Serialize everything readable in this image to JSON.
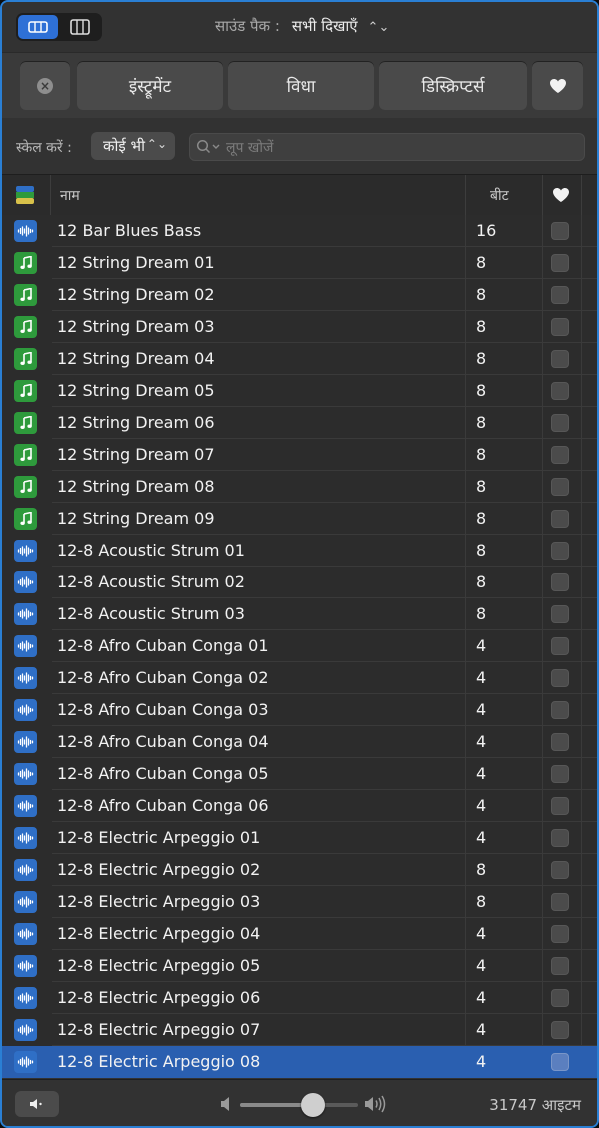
{
  "topbar": {
    "sound_pack_label": "साउंड पैक :",
    "sound_pack_value": "सभी दिखाएँ",
    "view_modes": [
      "button-view-icon",
      "column-view-icon"
    ]
  },
  "filters": {
    "clear_icon": "clear-icon",
    "instrument": "इंस्ट्रूमेंट",
    "genre": "विधा",
    "descriptors": "डिस्क्रिप्टर्स",
    "favorites_icon": "heart-icon"
  },
  "scale": {
    "label": "स्केल करें :",
    "value": "कोई भी"
  },
  "search": {
    "placeholder": "लूप खोजें",
    "value": ""
  },
  "table": {
    "columns": {
      "type_icon": "loop-type-icon",
      "name": "नाम",
      "beats": "बीट",
      "favorite_icon": "heart-icon"
    },
    "rows": [
      {
        "type": "audio",
        "name": "12 Bar Blues Bass",
        "beats": "16",
        "favorite": false,
        "selected": false
      },
      {
        "type": "midi",
        "name": "12 String Dream 01",
        "beats": "8",
        "favorite": false,
        "selected": false
      },
      {
        "type": "midi",
        "name": "12 String Dream 02",
        "beats": "8",
        "favorite": false,
        "selected": false
      },
      {
        "type": "midi",
        "name": "12 String Dream 03",
        "beats": "8",
        "favorite": false,
        "selected": false
      },
      {
        "type": "midi",
        "name": "12 String Dream 04",
        "beats": "8",
        "favorite": false,
        "selected": false
      },
      {
        "type": "midi",
        "name": "12 String Dream 05",
        "beats": "8",
        "favorite": false,
        "selected": false
      },
      {
        "type": "midi",
        "name": "12 String Dream 06",
        "beats": "8",
        "favorite": false,
        "selected": false
      },
      {
        "type": "midi",
        "name": "12 String Dream 07",
        "beats": "8",
        "favorite": false,
        "selected": false
      },
      {
        "type": "midi",
        "name": "12 String Dream 08",
        "beats": "8",
        "favorite": false,
        "selected": false
      },
      {
        "type": "midi",
        "name": "12 String Dream 09",
        "beats": "8",
        "favorite": false,
        "selected": false
      },
      {
        "type": "audio",
        "name": "12-8 Acoustic Strum 01",
        "beats": "8",
        "favorite": false,
        "selected": false
      },
      {
        "type": "audio",
        "name": "12-8 Acoustic Strum 02",
        "beats": "8",
        "favorite": false,
        "selected": false
      },
      {
        "type": "audio",
        "name": "12-8 Acoustic Strum 03",
        "beats": "8",
        "favorite": false,
        "selected": false
      },
      {
        "type": "audio",
        "name": "12-8 Afro Cuban Conga 01",
        "beats": "4",
        "favorite": false,
        "selected": false
      },
      {
        "type": "audio",
        "name": "12-8 Afro Cuban Conga 02",
        "beats": "4",
        "favorite": false,
        "selected": false
      },
      {
        "type": "audio",
        "name": "12-8 Afro Cuban Conga 03",
        "beats": "4",
        "favorite": false,
        "selected": false
      },
      {
        "type": "audio",
        "name": "12-8 Afro Cuban Conga 04",
        "beats": "4",
        "favorite": false,
        "selected": false
      },
      {
        "type": "audio",
        "name": "12-8 Afro Cuban Conga 05",
        "beats": "4",
        "favorite": false,
        "selected": false
      },
      {
        "type": "audio",
        "name": "12-8 Afro Cuban Conga 06",
        "beats": "4",
        "favorite": false,
        "selected": false
      },
      {
        "type": "audio",
        "name": "12-8 Electric Arpeggio 01",
        "beats": "4",
        "favorite": false,
        "selected": false
      },
      {
        "type": "audio",
        "name": "12-8 Electric Arpeggio 02",
        "beats": "8",
        "favorite": false,
        "selected": false
      },
      {
        "type": "audio",
        "name": "12-8 Electric Arpeggio 03",
        "beats": "8",
        "favorite": false,
        "selected": false
      },
      {
        "type": "audio",
        "name": "12-8 Electric Arpeggio 04",
        "beats": "4",
        "favorite": false,
        "selected": false
      },
      {
        "type": "audio",
        "name": "12-8 Electric Arpeggio 05",
        "beats": "4",
        "favorite": false,
        "selected": false
      },
      {
        "type": "audio",
        "name": "12-8 Electric Arpeggio 06",
        "beats": "4",
        "favorite": false,
        "selected": false
      },
      {
        "type": "audio",
        "name": "12-8 Electric Arpeggio 07",
        "beats": "4",
        "favorite": false,
        "selected": false
      },
      {
        "type": "audio",
        "name": "12-8 Electric Arpeggio 08",
        "beats": "4",
        "favorite": false,
        "selected": true
      }
    ]
  },
  "footer": {
    "preview_icon": "speaker-icon",
    "volume_level": 0.65,
    "count": "31747 आइटम"
  },
  "colors": {
    "accent": "#2e70d6",
    "audio_icon": "#2f6fc6",
    "midi_icon": "#2e9a3c",
    "selected_row": "#2a5fb0"
  }
}
